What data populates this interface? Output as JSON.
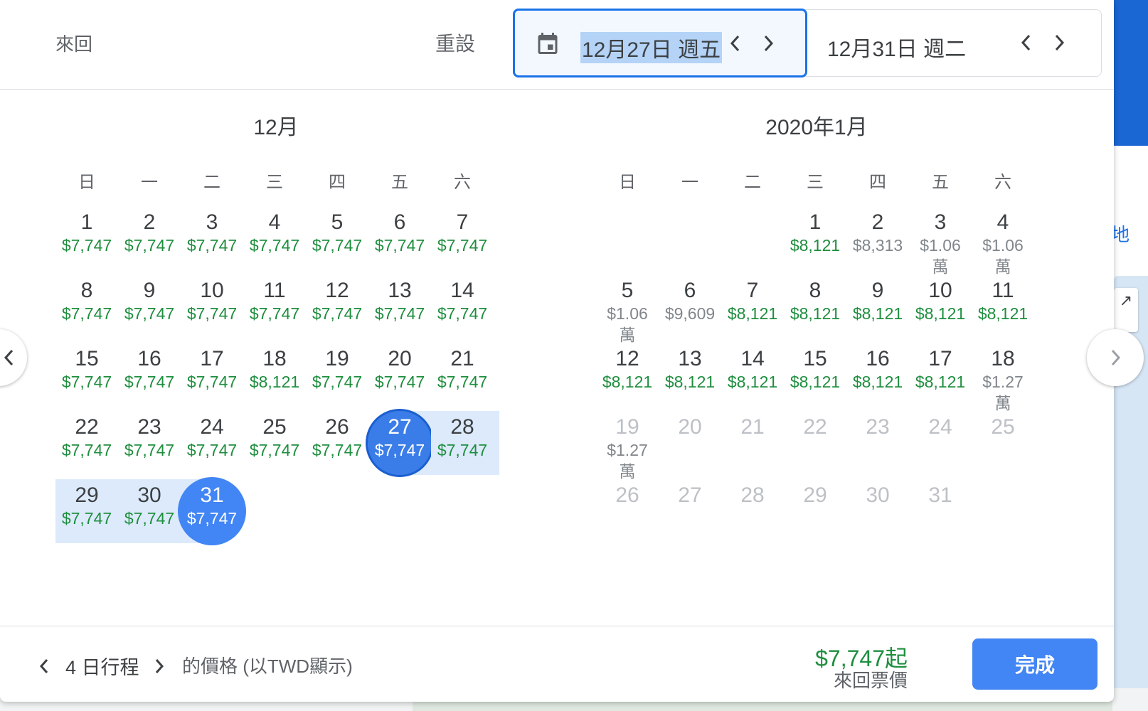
{
  "header": {
    "trip_type": "來回",
    "reset_label": "重設",
    "depart_date": "12月27日 週五",
    "return_date": "12月31日 週二"
  },
  "background": {
    "side_link_text": "地"
  },
  "weekdays": [
    "日",
    "一",
    "二",
    "三",
    "四",
    "五",
    "六"
  ],
  "months": [
    {
      "title": "12月",
      "first_weekday": 0,
      "days": [
        {
          "d": "1",
          "p": "$7,747"
        },
        {
          "d": "2",
          "p": "$7,747"
        },
        {
          "d": "3",
          "p": "$7,747"
        },
        {
          "d": "4",
          "p": "$7,747"
        },
        {
          "d": "5",
          "p": "$7,747"
        },
        {
          "d": "6",
          "p": "$7,747"
        },
        {
          "d": "7",
          "p": "$7,747"
        },
        {
          "d": "8",
          "p": "$7,747"
        },
        {
          "d": "9",
          "p": "$7,747"
        },
        {
          "d": "10",
          "p": "$7,747"
        },
        {
          "d": "11",
          "p": "$7,747"
        },
        {
          "d": "12",
          "p": "$7,747"
        },
        {
          "d": "13",
          "p": "$7,747"
        },
        {
          "d": "14",
          "p": "$7,747"
        },
        {
          "d": "15",
          "p": "$7,747"
        },
        {
          "d": "16",
          "p": "$7,747"
        },
        {
          "d": "17",
          "p": "$7,747"
        },
        {
          "d": "18",
          "p": "$8,121"
        },
        {
          "d": "19",
          "p": "$7,747"
        },
        {
          "d": "20",
          "p": "$7,747"
        },
        {
          "d": "21",
          "p": "$7,747"
        },
        {
          "d": "22",
          "p": "$7,747"
        },
        {
          "d": "23",
          "p": "$7,747"
        },
        {
          "d": "24",
          "p": "$7,747"
        },
        {
          "d": "25",
          "p": "$7,747"
        },
        {
          "d": "26",
          "p": "$7,747"
        },
        {
          "d": "27",
          "p": "$7,747",
          "state": "start"
        },
        {
          "d": "28",
          "p": "$7,747",
          "state": "range"
        },
        {
          "d": "29",
          "p": "$7,747",
          "state": "range"
        },
        {
          "d": "30",
          "p": "$7,747",
          "state": "range"
        },
        {
          "d": "31",
          "p": "$7,747",
          "state": "end"
        }
      ]
    },
    {
      "title": "2020年1月",
      "first_weekday": 3,
      "days": [
        {
          "d": "1",
          "p": "$8,121"
        },
        {
          "d": "2",
          "p": "$8,313",
          "tone": "grey"
        },
        {
          "d": "3",
          "p": "$1.06萬",
          "tone": "grey"
        },
        {
          "d": "4",
          "p": "$1.06萬",
          "tone": "grey"
        },
        {
          "d": "5",
          "p": "$1.06萬",
          "tone": "grey"
        },
        {
          "d": "6",
          "p": "$9,609",
          "tone": "grey"
        },
        {
          "d": "7",
          "p": "$8,121"
        },
        {
          "d": "8",
          "p": "$8,121"
        },
        {
          "d": "9",
          "p": "$8,121"
        },
        {
          "d": "10",
          "p": "$8,121"
        },
        {
          "d": "11",
          "p": "$8,121"
        },
        {
          "d": "12",
          "p": "$8,121"
        },
        {
          "d": "13",
          "p": "$8,121"
        },
        {
          "d": "14",
          "p": "$8,121"
        },
        {
          "d": "15",
          "p": "$8,121"
        },
        {
          "d": "16",
          "p": "$8,121"
        },
        {
          "d": "17",
          "p": "$8,121"
        },
        {
          "d": "18",
          "p": "$1.27萬",
          "tone": "grey"
        },
        {
          "d": "19",
          "p": "$1.27萬",
          "tone": "disabled"
        },
        {
          "d": "20",
          "p": "",
          "tone": "disabled"
        },
        {
          "d": "21",
          "p": "",
          "tone": "disabled"
        },
        {
          "d": "22",
          "p": "",
          "tone": "disabled"
        },
        {
          "d": "23",
          "p": "",
          "tone": "disabled"
        },
        {
          "d": "24",
          "p": "",
          "tone": "disabled"
        },
        {
          "d": "25",
          "p": "",
          "tone": "disabled"
        },
        {
          "d": "26",
          "p": "",
          "tone": "disabled"
        },
        {
          "d": "27",
          "p": "",
          "tone": "disabled"
        },
        {
          "d": "28",
          "p": "",
          "tone": "disabled"
        },
        {
          "d": "29",
          "p": "",
          "tone": "disabled"
        },
        {
          "d": "30",
          "p": "",
          "tone": "disabled"
        },
        {
          "d": "31",
          "p": "",
          "tone": "disabled"
        }
      ]
    }
  ],
  "footer": {
    "duration_label": "4 日行程",
    "duration_suffix": "的價格 (以TWD顯示)",
    "lowest_price": "$7,747起",
    "price_label": "來回票價",
    "done_label": "完成"
  },
  "colors": {
    "accent": "#1a73e8",
    "price_green": "#1e8e3e",
    "price_grey": "#80868b",
    "selected": "#4285f4",
    "range": "#dceafb"
  }
}
